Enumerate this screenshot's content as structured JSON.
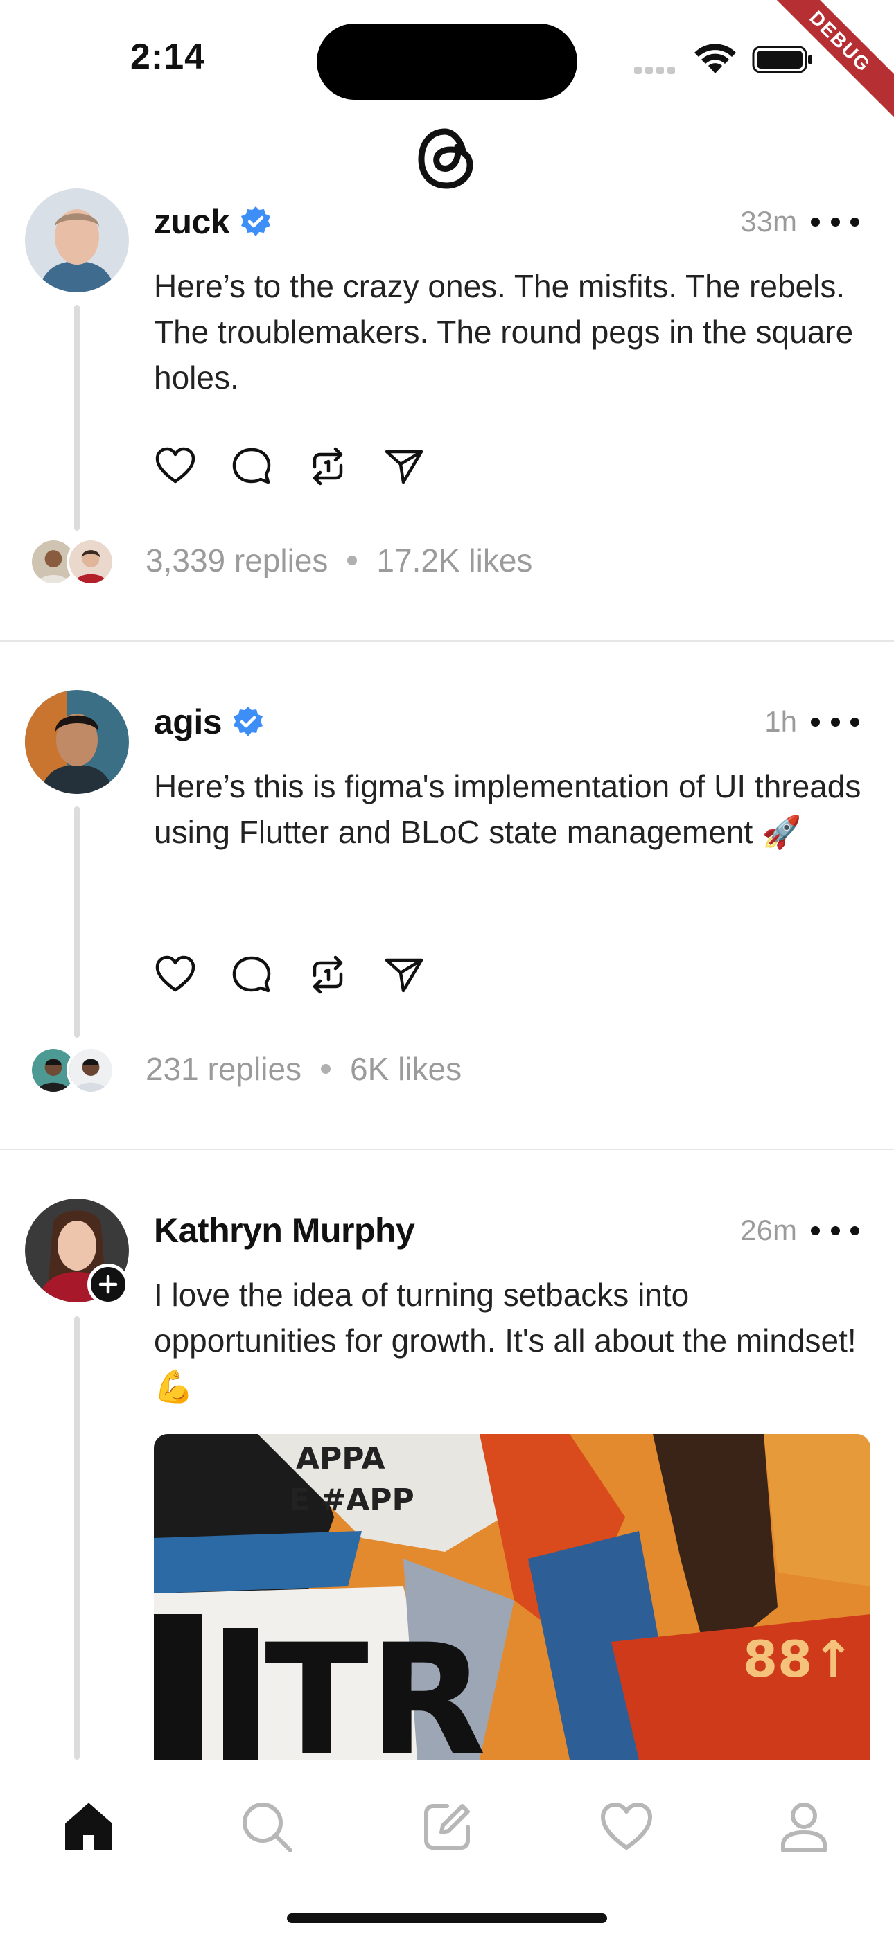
{
  "status_bar": {
    "time": "2:14",
    "debug_label": "DEBUG"
  },
  "feed": {
    "posts": [
      {
        "username": "zuck",
        "verified": true,
        "time": "33m",
        "text": "Here’s to the crazy ones. The misfits. The rebels. The troublemakers. The round pegs in the square holes.",
        "replies": "3,339 replies",
        "likes": "17.2K likes"
      },
      {
        "username": "agis",
        "verified": true,
        "time": "1h",
        "text": "Here’s this is figma's implementation of UI threads using Flutter and BLoC state management 🚀",
        "replies": "231 replies",
        "likes": "6K likes"
      },
      {
        "username": "Kathryn Murphy",
        "verified": false,
        "time": "26m",
        "text": "I love the idea of turning setbacks into opportunities for growth. It's all about the mindset! 💪",
        "image_text_1": "APPA",
        "image_text_2": "E #APP",
        "image_text_3": "TR",
        "image_text_4": "88↑"
      }
    ]
  },
  "actions": [
    "heart-icon",
    "comment-icon",
    "repost-icon",
    "share-icon"
  ],
  "bottom_nav": [
    "home-icon",
    "search-icon",
    "compose-icon",
    "activity-icon",
    "profile-icon"
  ],
  "colors": {
    "verified": "#3e8ef7",
    "muted_text": "#9b9b9b",
    "debug_ribbon": "#b52f33"
  }
}
